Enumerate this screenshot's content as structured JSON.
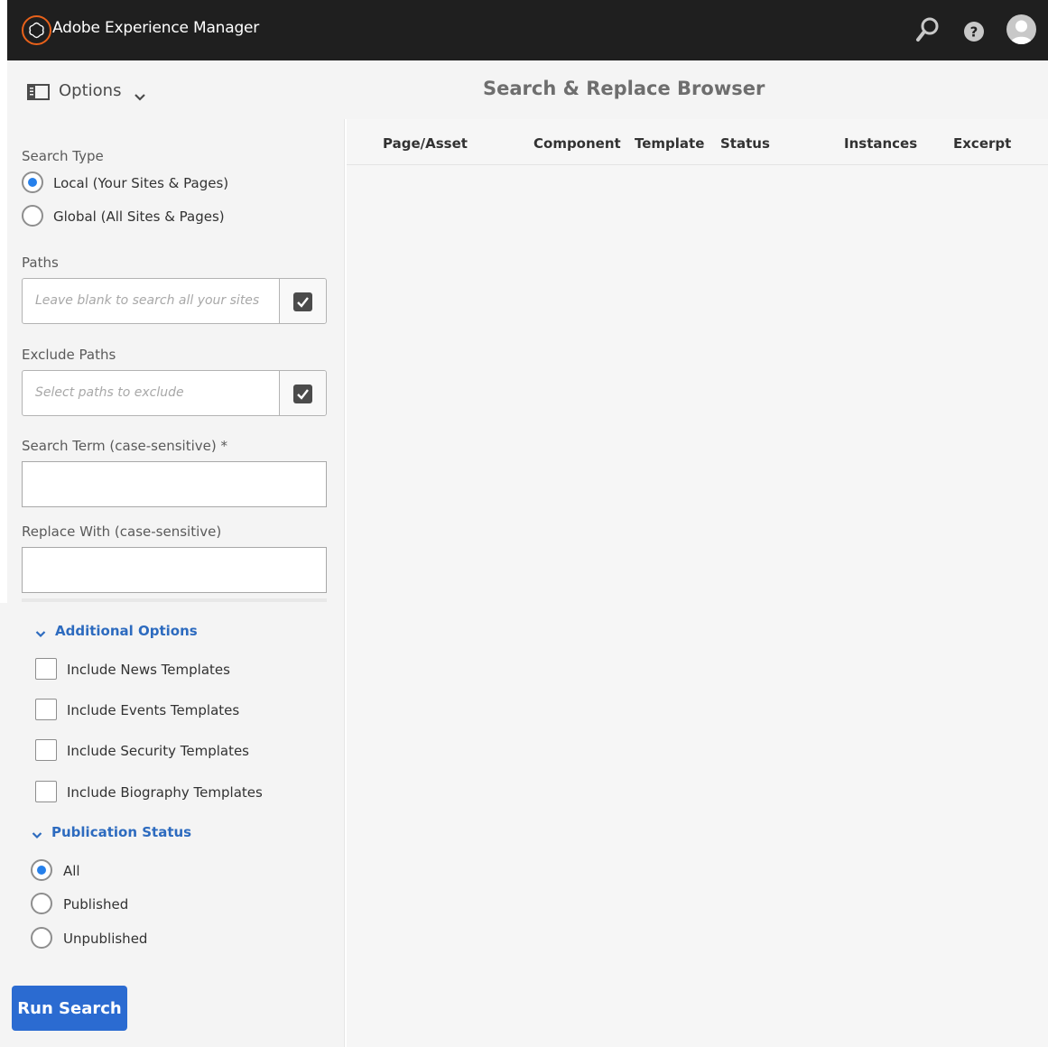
{
  "app": {
    "title": "Adobe Experience Manager"
  },
  "shell": {
    "icons": [
      "search-icon",
      "help-icon",
      "user-avatar-icon"
    ]
  },
  "actionbar": {
    "options_label": "Options",
    "page_title": "Search & Replace Browser"
  },
  "form": {
    "search_type": {
      "label": "Search Type",
      "options": [
        "Local (Your Sites & Pages)",
        "Global (All Sites & Pages)"
      ],
      "selected": "Local (Your Sites & Pages)"
    },
    "paths": {
      "label": "Paths",
      "placeholder": "Leave blank to search all your sites",
      "value": ""
    },
    "exclude_paths": {
      "label": "Exclude Paths",
      "placeholder": "Select paths to exclude",
      "value": ""
    },
    "search_term": {
      "label": "Search Term (case-sensitive) *",
      "value": ""
    },
    "replace_with": {
      "label": "Replace With (case-sensitive)",
      "value": ""
    },
    "additional_options": {
      "title": "Additional Options",
      "checkboxes": [
        "Include News Templates",
        "Include Events Templates",
        "Include Security Templates",
        "Include Biography Templates"
      ]
    },
    "publication_status": {
      "title": "Publication Status",
      "options": [
        "All",
        "Published",
        "Unpublished"
      ],
      "selected": "All"
    },
    "run_button": "Run Search"
  },
  "table": {
    "columns": [
      "Page/Asset",
      "Component",
      "Template",
      "Status",
      "Instances",
      "Excerpt"
    ]
  },
  "colors": {
    "shell": "#1f1f1f",
    "accent": "#2b6bd1",
    "logo": "#e8611a",
    "radio_selected": "#2680eb"
  }
}
